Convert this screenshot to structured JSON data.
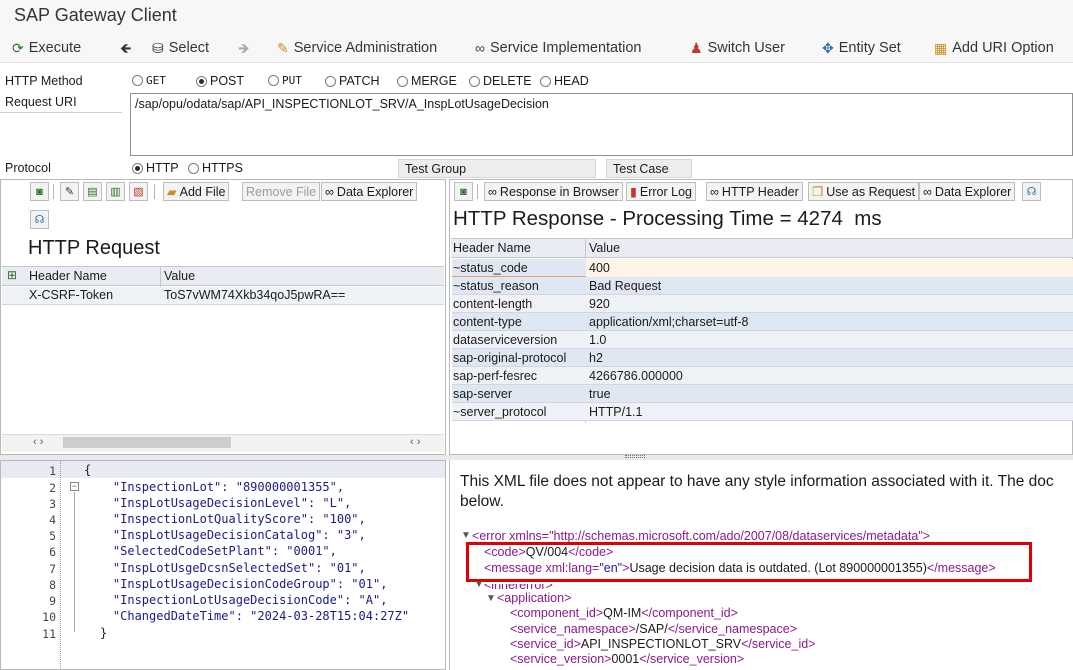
{
  "app": {
    "title": "SAP Gateway Client"
  },
  "toolbar": {
    "execute": "Execute",
    "select": "Select",
    "service_admin": "Service Administration",
    "service_impl": "Service Implementation",
    "switch_user": "Switch User",
    "entity_set": "Entity Set",
    "add_uri_option": "Add URI Option"
  },
  "form": {
    "http_method_label": "HTTP Method",
    "methods": [
      "GET",
      "POST",
      "PUT",
      "PATCH",
      "MERGE",
      "DELETE",
      "HEAD"
    ],
    "selected_method": "POST",
    "request_uri_label": "Request URI",
    "request_uri": "/sap/opu/odata/sap/API_INSPECTIONLOT_SRV/A_InspLotUsageDecision",
    "protocol_label": "Protocol",
    "protocols": [
      "HTTP",
      "HTTPS"
    ],
    "selected_protocol": "HTTP",
    "test_group_label": "Test Group",
    "test_case_label": "Test Case"
  },
  "request": {
    "add_file": "Add File",
    "remove_file": "Remove File",
    "data_explorer": "Data Explorer",
    "title": "HTTP Request",
    "col_header_name": "Header Name",
    "col_value": "Value",
    "headers": [
      {
        "name": "X-CSRF-Token",
        "value": "ToS7vWM74Xkb34qoJ5pwRA=="
      }
    ],
    "body_lines": [
      {
        "num": "1",
        "text": "{"
      },
      {
        "num": "2",
        "text": "    \"InspectionLot\": \"890000001355\","
      },
      {
        "num": "3",
        "text": "    \"InspLotUsageDecisionLevel\": \"L\","
      },
      {
        "num": "4",
        "text": "    \"InspectionLotQualityScore\": \"100\","
      },
      {
        "num": "5",
        "text": "    \"InspLotUsageDecisionCatalog\": \"3\","
      },
      {
        "num": "6",
        "text": "    \"SelectedCodeSetPlant\": \"0001\","
      },
      {
        "num": "7",
        "text": "    \"InspLotUsgeDcsnSelectedSet\": \"01\","
      },
      {
        "num": "8",
        "text": "    \"InspLotUsageDecisionCodeGroup\": \"01\","
      },
      {
        "num": "9",
        "text": "    \"InspectionLotUsageDecisionCode\": \"A\","
      },
      {
        "num": "10",
        "text": "    \"ChangedDateTime\": \"2024-03-28T15:04:27Z\""
      },
      {
        "num": "11",
        "text": "}"
      }
    ]
  },
  "response": {
    "response_in_browser": "Response in Browser",
    "error_log": "Error Log",
    "http_header": "HTTP Header",
    "use_as_request": "Use as Request",
    "data_explorer": "Data Explorer",
    "title": "HTTP Response - Processing Time = 4274  ms",
    "col_header_name": "Header Name",
    "col_value": "Value",
    "headers": [
      {
        "name": "~status_code",
        "value": "400"
      },
      {
        "name": "~status_reason",
        "value": "Bad Request"
      },
      {
        "name": "content-length",
        "value": "920"
      },
      {
        "name": "content-type",
        "value": "application/xml;charset=utf-8"
      },
      {
        "name": "dataserviceversion",
        "value": "1.0"
      },
      {
        "name": "sap-original-protocol",
        "value": "h2"
      },
      {
        "name": "sap-perf-fesrec",
        "value": "4266786.000000"
      },
      {
        "name": "sap-server",
        "value": "true"
      },
      {
        "name": "~server_protocol",
        "value": "HTTP/1.1"
      }
    ],
    "xml_notice_1": "This XML file does not appear to have any style information associated with it. The doc",
    "xml_notice_2": "below.",
    "xml": {
      "error_open": "<error xmlns=\"http://schemas.microsoft.com/ado/2007/08/dataservices/metadata\">",
      "code_open": "<code>",
      "code_value": "QV/004",
      "code_close": "</code>",
      "message_open_a": "<message xml:lang=",
      "message_lang": "\"en\"",
      "message_open_b": ">",
      "message_value": "Usage decision data is outdated. (Lot 890000001355)",
      "message_close": "</message>",
      "innererror_open": "<innererror>",
      "application_open": "<application>",
      "component_open": "<component_id>",
      "component_value": "QM-IM",
      "component_close": "</component_id>",
      "namespace_open": "<service_namespace>",
      "namespace_value": "/SAP/",
      "namespace_close": "</service_namespace>",
      "service_id_open": "<service_id>",
      "service_id_value": "API_INSPECTIONLOT_SRV",
      "service_id_close": "</service_id>",
      "version_open": "<service_version>",
      "version_value": "0001",
      "version_close": "</service_version>"
    }
  },
  "colors": {
    "highlight_box": "#e00000",
    "selected_row": "#fdf3e6",
    "header_bg": "#e8edf3"
  }
}
